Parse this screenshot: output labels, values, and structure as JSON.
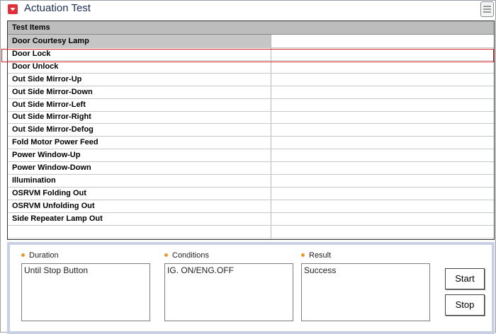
{
  "header": {
    "title": "Actuation Test",
    "icon": "dropdown-icon",
    "menu_icon": "menu-icon"
  },
  "table": {
    "column_header": "Test Items",
    "rows": [
      "Door Courtesy Lamp",
      "Door Lock",
      "Door Unlock",
      "Out Side Mirror-Up",
      "Out Side Mirror-Down",
      "Out Side Mirror-Left",
      "Out Side Mirror-Right",
      "Out Side Mirror-Defog",
      "Fold Motor Power Feed",
      "Power Window-Up",
      "Power Window-Down",
      "Illumination",
      "OSRVM Folding Out",
      "OSRVM Unfolding Out",
      "Side Repeater Lamp Out"
    ],
    "selected_row": "Door Courtesy Lamp",
    "highlighted_row": "Door Lock"
  },
  "panel": {
    "duration_label": "Duration",
    "duration_value": "Until Stop Button",
    "conditions_label": "Conditions",
    "conditions_value": "IG. ON/ENG.OFF",
    "result_label": "Result",
    "result_value": "Success",
    "start_label": "Start",
    "stop_label": "Stop"
  },
  "colors": {
    "accent": "#e0313a",
    "title": "#1e2d52",
    "highlight_border": "#d62020",
    "panel_border": "#c7d1e3",
    "bullet": "#e69a2b"
  }
}
